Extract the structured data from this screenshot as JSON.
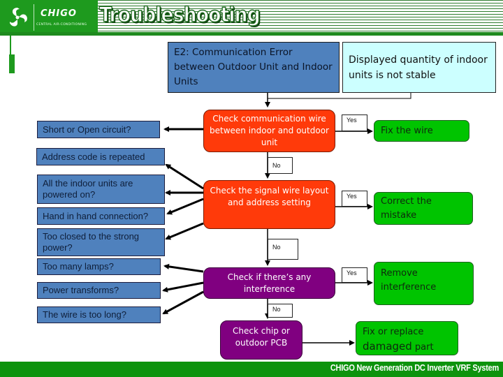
{
  "header": {
    "brand": "CHIGO",
    "brand_subtitle": "CENTRAL AIR-CONDITIONING",
    "logo_icon": "chigo-fan-logo-icon",
    "title": "Troubleshooting"
  },
  "top": {
    "error_box": "E2: Communication Error between Outdoor Unit and Indoor Units",
    "symptom_box": "Displayed quantity of indoor units is not stable"
  },
  "checks": [
    {
      "label": "Check communication wire between indoor and outdoor unit",
      "color": "#ff3a0a"
    },
    {
      "label": "Check the signal wire layout and address setting",
      "color": "#ff3a0a"
    },
    {
      "label": "Check if there’s any interference",
      "color": "#800080"
    },
    {
      "label": "Check chip or outdoor PCB",
      "color": "#800080"
    }
  ],
  "branch_labels": {
    "yes": "Yes",
    "no": "No"
  },
  "fixes": [
    {
      "label": "Fix the wire"
    },
    {
      "label": "Correct  the mistake"
    },
    {
      "label": "Remove interference"
    },
    {
      "label_line1": "Fix or replace",
      "label_line2a": "damaged",
      "label_line2b": " part"
    }
  ],
  "causes": [
    "Short or Open circuit?",
    "Address code is repeated",
    "All the indoor units are powered on?",
    "Hand in hand connection?",
    "Too closed to the strong power?",
    "Too many lamps?",
    "Power transforms?",
    "The wire is too long?"
  ],
  "colors": {
    "brand_green": "#1e9a1e",
    "cause_blue": "#4f81bd",
    "symptom_cyan": "#ccffff",
    "check_red": "#ff3a0a",
    "check_purple": "#800080",
    "fix_green": "#00c400"
  },
  "footer": {
    "text": "CHIGO New Generation DC Inverter VRF System"
  }
}
